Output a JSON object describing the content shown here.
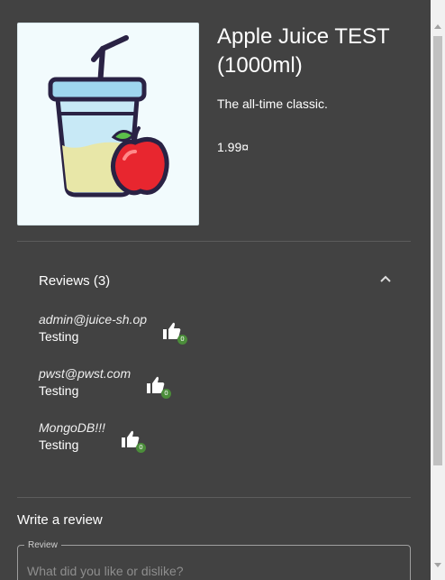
{
  "product": {
    "title": "Apple Juice TEST (1000ml)",
    "description": "The all-time classic.",
    "price": "1.99¤",
    "image_icon": "apple-juice-image"
  },
  "reviews": {
    "header": "Reviews (3)",
    "items": [
      {
        "author": "admin@juice-sh.op",
        "message": "Testing",
        "likes": "0"
      },
      {
        "author": "pwst@pwst.com",
        "message": "Testing",
        "likes": "0"
      },
      {
        "author": "MongoDB!!!",
        "message": "Testing",
        "likes": "0"
      }
    ]
  },
  "write_review": {
    "title": "Write a review",
    "label": "Review",
    "placeholder": "What did you like or dislike?"
  },
  "colors": {
    "background": "#424242",
    "like_badge": "#4b8d3a"
  }
}
